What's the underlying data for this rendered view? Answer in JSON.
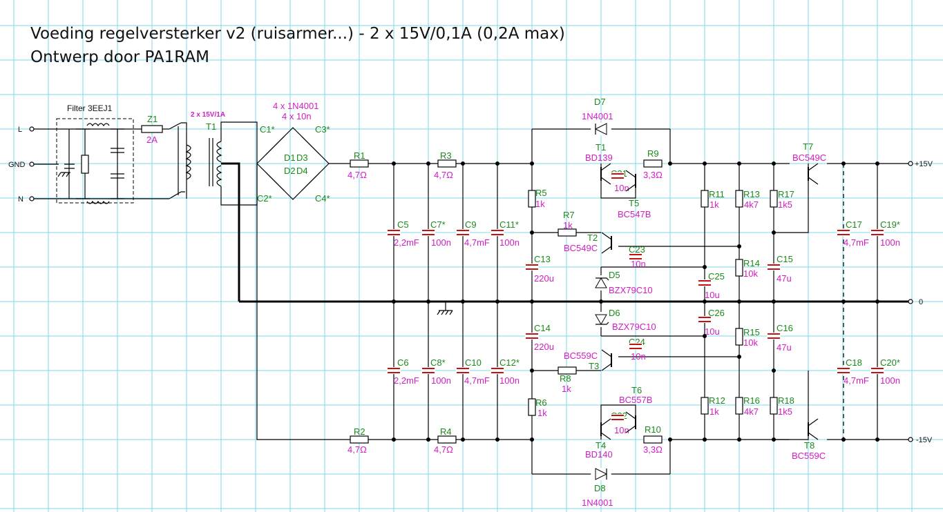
{
  "title": {
    "line1": "Voeding regelversterker v2 (ruisarmer...) - 2 x 15V/0,1A (0,2A max)",
    "line2": "Ontwerp door PA1RAM"
  },
  "mains_terminals": {
    "l": "L",
    "gnd": "GND",
    "n": "N"
  },
  "filter": {
    "label": "Filter 3EEJ1"
  },
  "fuse": {
    "ref": "Z1",
    "value": "2A"
  },
  "transformer": {
    "ref": "T1",
    "rating": "2 x 15V/1A"
  },
  "bridge": {
    "note1": "4 x 1N4001",
    "note2": "4 x 10n",
    "diodes": [
      "D1",
      "D2",
      "D3",
      "D4"
    ],
    "caps": [
      "C1*",
      "C2*",
      "C3*",
      "C4*"
    ]
  },
  "outputs": {
    "pos": "+15V",
    "zero": "0",
    "neg": "-15V"
  },
  "components": {
    "R1": {
      "ref": "R1",
      "value": "4,7Ω"
    },
    "R2": {
      "ref": "R2",
      "value": "4,7Ω"
    },
    "R3": {
      "ref": "R3",
      "value": "4,7Ω"
    },
    "R4": {
      "ref": "R4",
      "value": "4,7Ω"
    },
    "C5": {
      "ref": "C5",
      "value": "2,2mF"
    },
    "C6": {
      "ref": "C6",
      "value": "2,2mF"
    },
    "C7": {
      "ref": "C7*",
      "value": "100n"
    },
    "C8": {
      "ref": "C8*",
      "value": "100n"
    },
    "C9": {
      "ref": "C9",
      "value": "4,7mF"
    },
    "C10": {
      "ref": "C10",
      "value": "4,7mF"
    },
    "C11": {
      "ref": "C11*",
      "value": "100n"
    },
    "C12": {
      "ref": "C12*",
      "value": "100n"
    },
    "C13": {
      "ref": "C13",
      "value": "220u"
    },
    "C14": {
      "ref": "C14",
      "value": "220u"
    },
    "R5": {
      "ref": "R5",
      "value": "1k"
    },
    "R6": {
      "ref": "R6",
      "value": "1k"
    },
    "R7": {
      "ref": "R7",
      "value": "1k"
    },
    "R8": {
      "ref": "R8",
      "value": "1k"
    },
    "D7": {
      "ref": "D7",
      "value": "1N4001"
    },
    "D8": {
      "ref": "D8",
      "value": "1N4001"
    },
    "T1b": {
      "ref": "T1",
      "value": "BD139"
    },
    "T4": {
      "ref": "T4",
      "value": "BD140"
    },
    "C21": {
      "ref": "C21",
      "value": "10n"
    },
    "C22": {
      "ref": "C22",
      "value": "10n"
    },
    "R9": {
      "ref": "R9",
      "value": "3,3Ω"
    },
    "R10": {
      "ref": "R10",
      "value": "3,3Ω"
    },
    "T5": {
      "ref": "T5",
      "value": "BC547B"
    },
    "T6": {
      "ref": "T6",
      "value": "BC557B"
    },
    "T2": {
      "ref": "T2",
      "value": "BC549C"
    },
    "T3": {
      "ref": "T3",
      "value": "BC559C"
    },
    "C23": {
      "ref": "C23",
      "value": "10n"
    },
    "C24": {
      "ref": "C24",
      "value": "10n"
    },
    "D5": {
      "ref": "D5",
      "value": "BZX79C10"
    },
    "D6": {
      "ref": "D6",
      "value": "BZX79C10"
    },
    "C25": {
      "ref": "C25",
      "value": "10u"
    },
    "C26": {
      "ref": "C26",
      "value": "10u"
    },
    "R11": {
      "ref": "R11",
      "value": "1k"
    },
    "R12": {
      "ref": "R12",
      "value": "1k"
    },
    "R13": {
      "ref": "R13",
      "value": "4k7"
    },
    "R14": {
      "ref": "R14",
      "value": "10k"
    },
    "R15": {
      "ref": "R15",
      "value": "10k"
    },
    "R16": {
      "ref": "R16",
      "value": "4k7"
    },
    "R17": {
      "ref": "R17",
      "value": "1k5"
    },
    "R18": {
      "ref": "R18",
      "value": "1k5"
    },
    "C15": {
      "ref": "C15",
      "value": "47u"
    },
    "C16": {
      "ref": "C16",
      "value": "47u"
    },
    "T7": {
      "ref": "T7",
      "value": "BC549C"
    },
    "T8": {
      "ref": "T8",
      "value": "BC559C"
    },
    "C17": {
      "ref": "C17",
      "value": "4,7mF"
    },
    "C18": {
      "ref": "C18",
      "value": "4,7mF"
    },
    "C19": {
      "ref": "C19*",
      "value": "100n"
    },
    "C20": {
      "ref": "C20*",
      "value": "100n"
    }
  },
  "colors": {
    "grid": "#7ed8ea",
    "ref_label": "#1a8a1a",
    "value_label": "#d21cc4",
    "wire": "#000000",
    "film_cap": "#c81010"
  }
}
